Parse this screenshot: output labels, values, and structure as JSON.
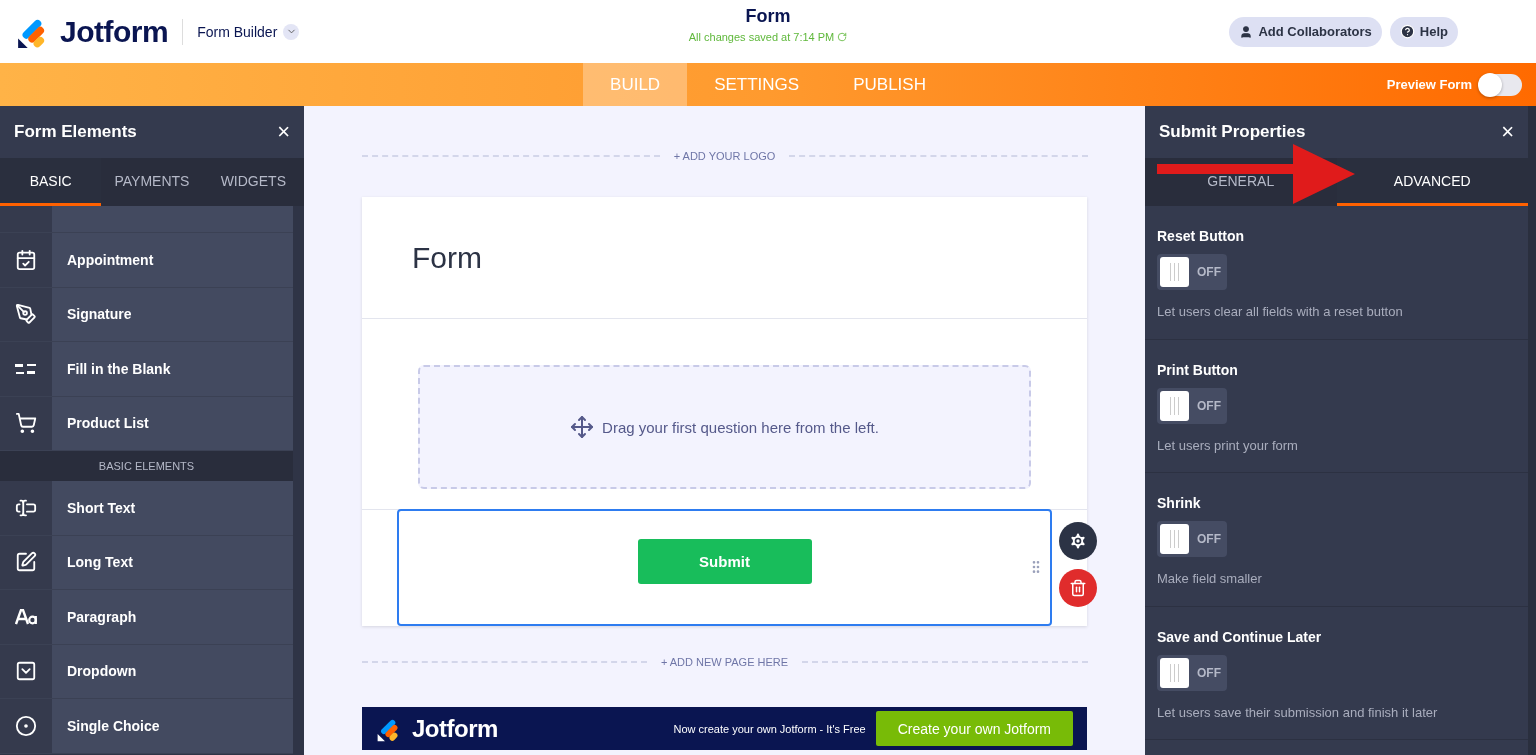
{
  "header": {
    "logo": "Jotform",
    "app_switcher": "Form Builder",
    "title": "Form",
    "save_status": "All changes saved at 7:14 PM",
    "buttons": [
      {
        "kind": "collaborators",
        "label": "Add Collaborators"
      },
      {
        "kind": "help",
        "label": "Help"
      }
    ]
  },
  "nav": {
    "tabs": [
      {
        "label": "BUILD",
        "selected": true
      },
      {
        "label": "SETTINGS",
        "selected": false
      },
      {
        "label": "PUBLISH",
        "selected": false
      }
    ],
    "preview": {
      "label": "Preview Form",
      "on": false
    }
  },
  "left_panel": {
    "title": "Form Elements",
    "close": "×",
    "tabs": [
      {
        "label": "BASIC",
        "selected": true
      },
      {
        "label": "PAYMENTS",
        "selected": false
      },
      {
        "label": "WIDGETS",
        "selected": false
      }
    ],
    "items": [
      {
        "kind": "item",
        "label": "Appointment"
      },
      {
        "kind": "item",
        "label": "Signature"
      },
      {
        "kind": "item",
        "label": "Fill in the Blank"
      },
      {
        "kind": "item",
        "label": "Product List"
      },
      {
        "kind": "section",
        "label": "BASIC ELEMENTS"
      },
      {
        "kind": "item",
        "label": "Short Text"
      },
      {
        "kind": "item",
        "label": "Long Text"
      },
      {
        "kind": "item",
        "label": "Paragraph"
      },
      {
        "kind": "item",
        "label": "Dropdown"
      },
      {
        "kind": "item",
        "label": "Single Choice"
      }
    ]
  },
  "canvas": {
    "add_logo": "+ ADD YOUR LOGO",
    "form_title": "Form",
    "drop_hint": "Drag your first question here from the left.",
    "submit": "Submit",
    "add_page": "+ ADD NEW PAGE HERE",
    "banner": {
      "logo": "Jotform",
      "text": "Now create your own Jotform - It's Free",
      "button": "Create your own Jotform"
    }
  },
  "right_panel": {
    "title": "Submit Properties",
    "close": "×",
    "tabs": [
      {
        "label": "GENERAL",
        "selected": false
      },
      {
        "label": "ADVANCED",
        "selected": true
      }
    ],
    "settings": [
      {
        "label": "Reset Button",
        "on": false,
        "state": "OFF",
        "description": "Let users clear all fields with a reset button"
      },
      {
        "label": "Print Button",
        "on": false,
        "state": "OFF",
        "description": "Let users print your form"
      },
      {
        "label": "Shrink",
        "on": false,
        "state": "OFF",
        "description": "Make field smaller"
      },
      {
        "label": "Save and Continue Later",
        "on": false,
        "state": "OFF",
        "description": "Let users save their submission and finish it later"
      }
    ]
  }
}
